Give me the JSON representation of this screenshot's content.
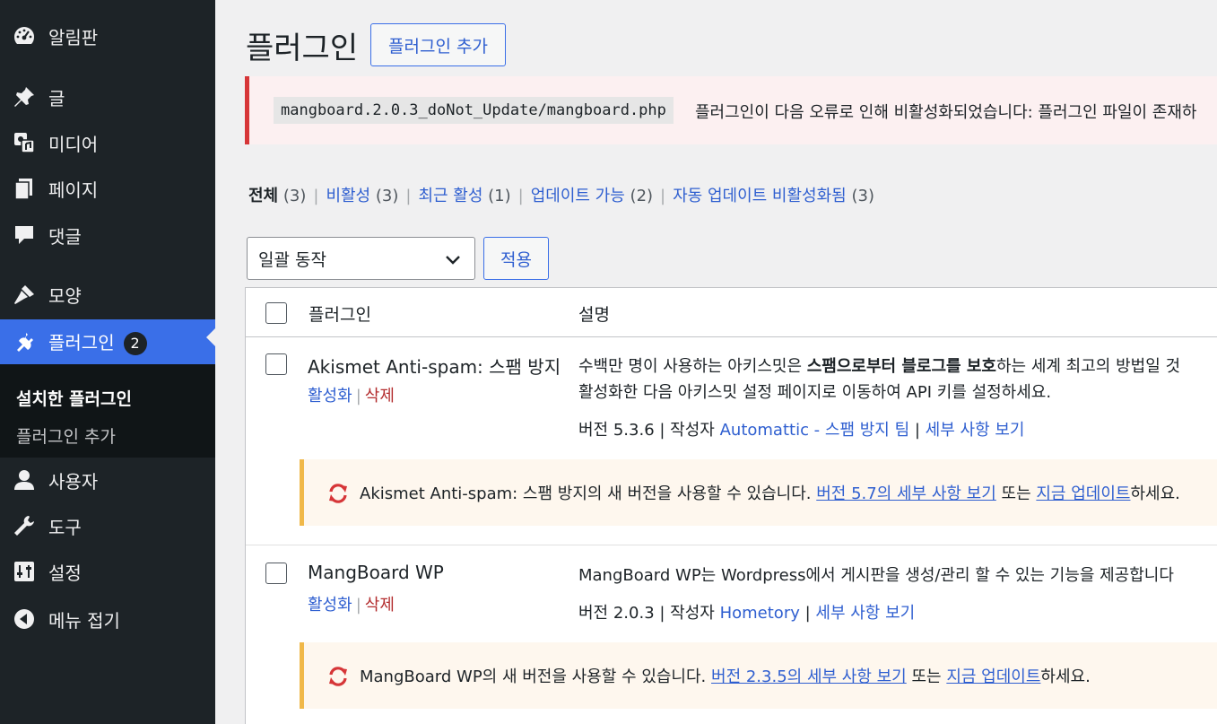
{
  "sidebar": {
    "items": [
      {
        "id": "dashboard",
        "label": "알림판",
        "icon": "dashboard-icon"
      },
      {
        "id": "posts",
        "label": "글",
        "icon": "pin-icon"
      },
      {
        "id": "media",
        "label": "미디어",
        "icon": "media-icon"
      },
      {
        "id": "pages",
        "label": "페이지",
        "icon": "pages-icon"
      },
      {
        "id": "comments",
        "label": "댓글",
        "icon": "comment-icon"
      },
      {
        "id": "appearance",
        "label": "모양",
        "icon": "brush-icon"
      },
      {
        "id": "plugins",
        "label": "플러그인",
        "icon": "plugin-icon",
        "badge": "2"
      },
      {
        "id": "users",
        "label": "사용자",
        "icon": "user-icon"
      },
      {
        "id": "tools",
        "label": "도구",
        "icon": "wrench-icon"
      },
      {
        "id": "settings",
        "label": "설정",
        "icon": "settings-icon"
      },
      {
        "id": "collapse",
        "label": "메뉴 접기",
        "icon": "collapse-icon"
      }
    ],
    "submenu": {
      "installed": "설치한 플러그인",
      "add_new": "플러그인 추가"
    }
  },
  "header": {
    "title": "플러그인",
    "add_button": "플러그인 추가"
  },
  "error_notice": {
    "code": "mangboard.2.0.3_doNot_Update/mangboard.php",
    "message": "플러그인이 다음 오류로 인해 비활성화되었습니다: 플러그인 파일이 존재하"
  },
  "filters": [
    {
      "label": "전체",
      "count": "(3)",
      "current": true
    },
    {
      "label": "비활성",
      "count": "(3)"
    },
    {
      "label": "최근 활성",
      "count": "(1)"
    },
    {
      "label": "업데이트 가능",
      "count": "(2)"
    },
    {
      "label": "자동 업데이트 비활성화됨",
      "count": "(3)"
    }
  ],
  "bulk": {
    "selected": "일괄 동작",
    "apply": "적용"
  },
  "table": {
    "col_plugin": "플러그인",
    "col_desc": "설명"
  },
  "plugins": [
    {
      "name": "Akismet Anti-spam: 스팸 방지",
      "activate": "활성화",
      "delete": "삭제",
      "desc_pre": "수백만 명이 사용하는 아키스밋은 ",
      "desc_bold": "스팸으로부터 블로그를 보호",
      "desc_post": "하는 세계 최고의 방법일 것",
      "desc_line2": "활성화한 다음 아키스밋 설정 페이지로 이동하여 API 키를 설정하세요.",
      "version": "버전 5.3.6",
      "author_label": "작성자",
      "author": "Automattic - 스팸 방지 팀",
      "details": "세부 사항 보기",
      "update_pre": "Akismet Anti-spam: 스팸 방지의 새 버전을 사용할 수 있습니다. ",
      "update_link1": "버전 5.7의 세부 사항 보기",
      "update_mid": " 또는 ",
      "update_link2": "지금 업데이트",
      "update_post": "하세요."
    },
    {
      "name": "MangBoard WP",
      "activate": "활성화",
      "delete": "삭제",
      "desc_line1": "MangBoard WP는 Wordpress에서 게시판을 생성/관리 할 수 있는 기능을 제공합니다",
      "version": "버전 2.0.3",
      "author_label": "작성자",
      "author": "Hometory",
      "details": "세부 사항 보기",
      "update_pre": "MangBoard WP의 새 버전을 사용할 수 있습니다. ",
      "update_link1": "버전 2.3.5의 세부 사항 보기",
      "update_mid": " 또는 ",
      "update_link2": "지금 업데이트",
      "update_post": "하세요."
    }
  ]
}
